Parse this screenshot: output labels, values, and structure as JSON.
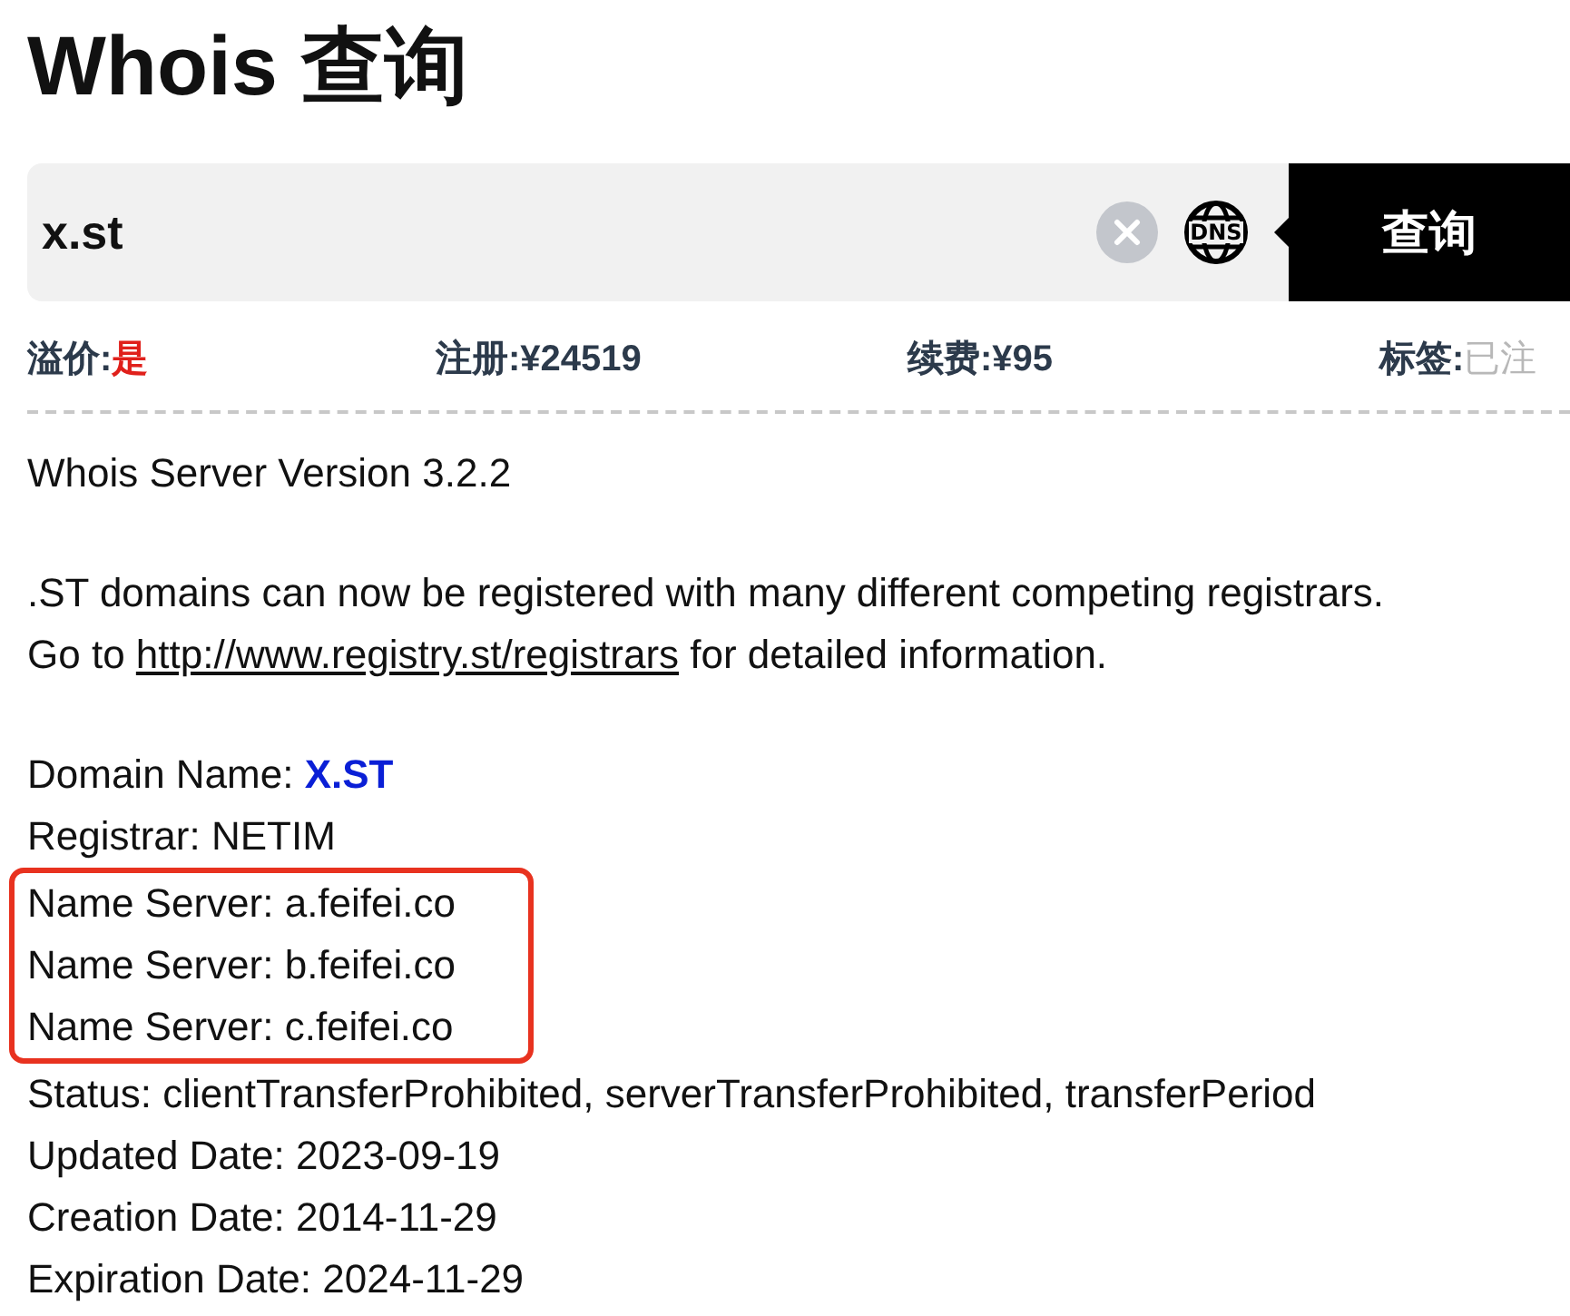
{
  "title": "Whois 查询",
  "search": {
    "value": "x.st",
    "dns_label": "DNS",
    "button": "查询"
  },
  "stats": [
    {
      "label": "溢价:",
      "value": "是",
      "kind": "alert"
    },
    {
      "label": "注册:",
      "value": "¥24519",
      "kind": "plain"
    },
    {
      "label": "续费:",
      "value": "¥95",
      "kind": "plain"
    },
    {
      "label": "标签:",
      "value": "已注",
      "kind": "muted"
    }
  ],
  "whois": {
    "header": "Whois Server Version 3.2.2",
    "notice_line": ".ST domains can now be registered with many different competing registrars.",
    "link_line": {
      "before": "Go to ",
      "link": "http://www.registry.st/registrars",
      "after": " for detailed information."
    },
    "records": [
      {
        "label": "Domain Name: ",
        "value": "X.ST",
        "kind": "domain",
        "highlighted": false
      },
      {
        "label": "Registrar: ",
        "value": "NETIM",
        "kind": "plain",
        "highlighted": false
      },
      {
        "label": "Name Server: ",
        "value": "a.feifei.co",
        "kind": "plain",
        "highlighted": true
      },
      {
        "label": "Name Server: ",
        "value": "b.feifei.co",
        "kind": "plain",
        "highlighted": true
      },
      {
        "label": "Name Server: ",
        "value": "c.feifei.co",
        "kind": "plain",
        "highlighted": true
      },
      {
        "label": "Status: ",
        "value": "clientTransferProhibited, serverTransferProhibited, transferPeriod",
        "kind": "plain",
        "highlighted": false
      },
      {
        "label": "Updated Date: ",
        "value": "2023-09-19",
        "kind": "plain",
        "highlighted": false
      },
      {
        "label": "Creation Date: ",
        "value": "2014-11-29",
        "kind": "plain",
        "highlighted": false
      },
      {
        "label": "Expiration Date: ",
        "value": "2024-11-29",
        "kind": "plain",
        "highlighted": false
      }
    ]
  }
}
